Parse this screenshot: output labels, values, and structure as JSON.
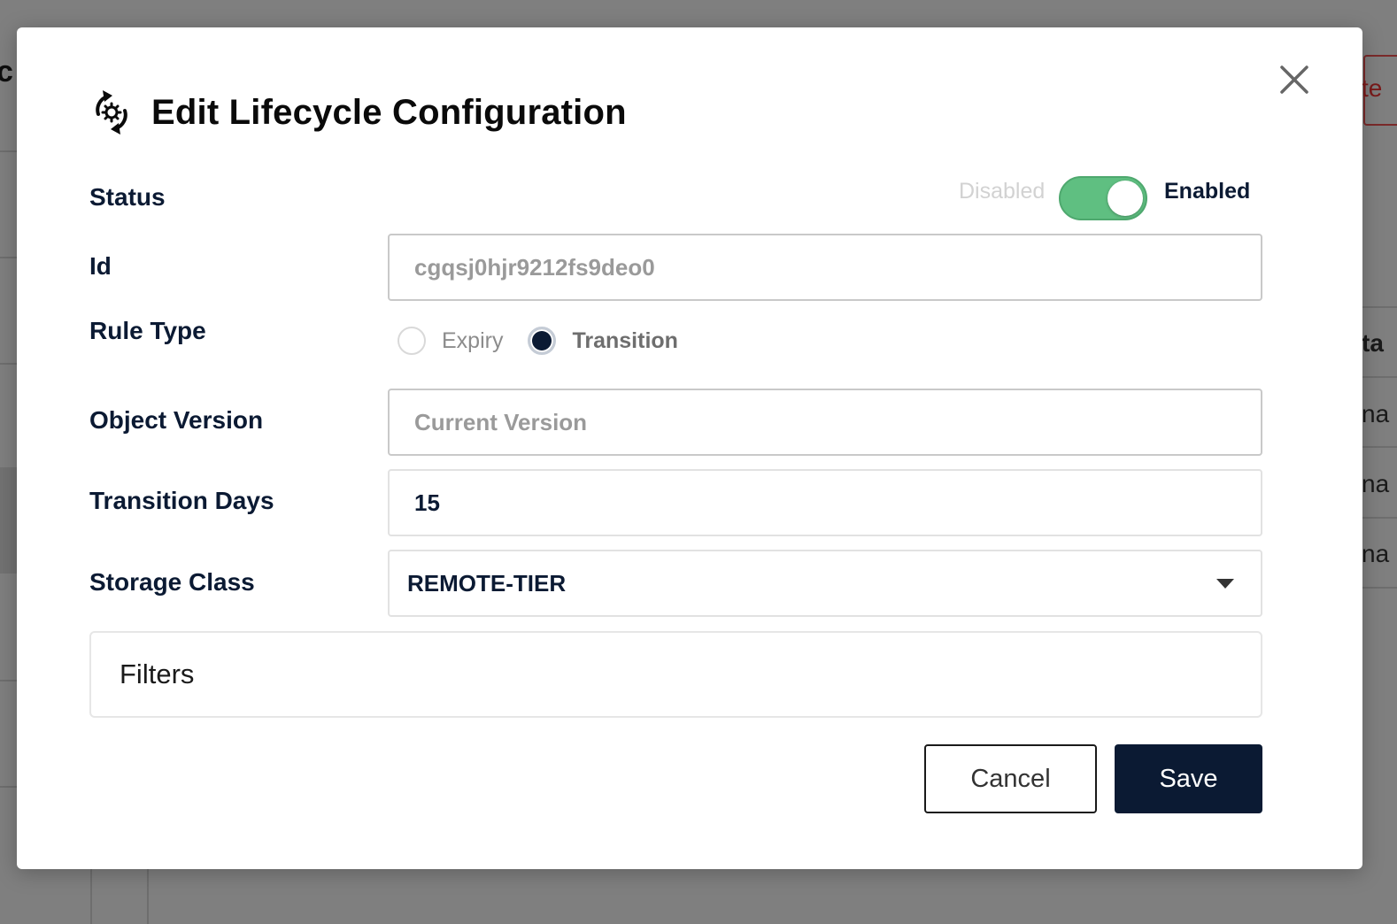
{
  "background": {
    "left_fragment": "c",
    "right_fragments": [
      "te",
      "ta",
      "na",
      "na",
      "na"
    ]
  },
  "modal": {
    "title": "Edit Lifecycle Configuration",
    "title_icon": "lifecycle-arrows-gear-icon",
    "close_icon": "close-icon"
  },
  "form": {
    "status": {
      "label": "Status",
      "off_label": "Disabled",
      "on_label": "Enabled",
      "enabled": true,
      "color_on": "#5fbf81"
    },
    "id": {
      "label": "Id",
      "value": "cgqsj0hjr9212fs9deo0"
    },
    "rule_type": {
      "label": "Rule Type",
      "options": [
        "Expiry",
        "Transition"
      ],
      "selected": "Transition"
    },
    "object_version": {
      "label": "Object Version",
      "value": "Current Version"
    },
    "transition_days": {
      "label": "Transition Days",
      "value": "15"
    },
    "storage_class": {
      "label": "Storage Class",
      "value": "REMOTE-TIER"
    },
    "filters": {
      "label": "Filters"
    }
  },
  "actions": {
    "cancel_label": "Cancel",
    "save_label": "Save",
    "primary_color": "#0b1a33"
  }
}
